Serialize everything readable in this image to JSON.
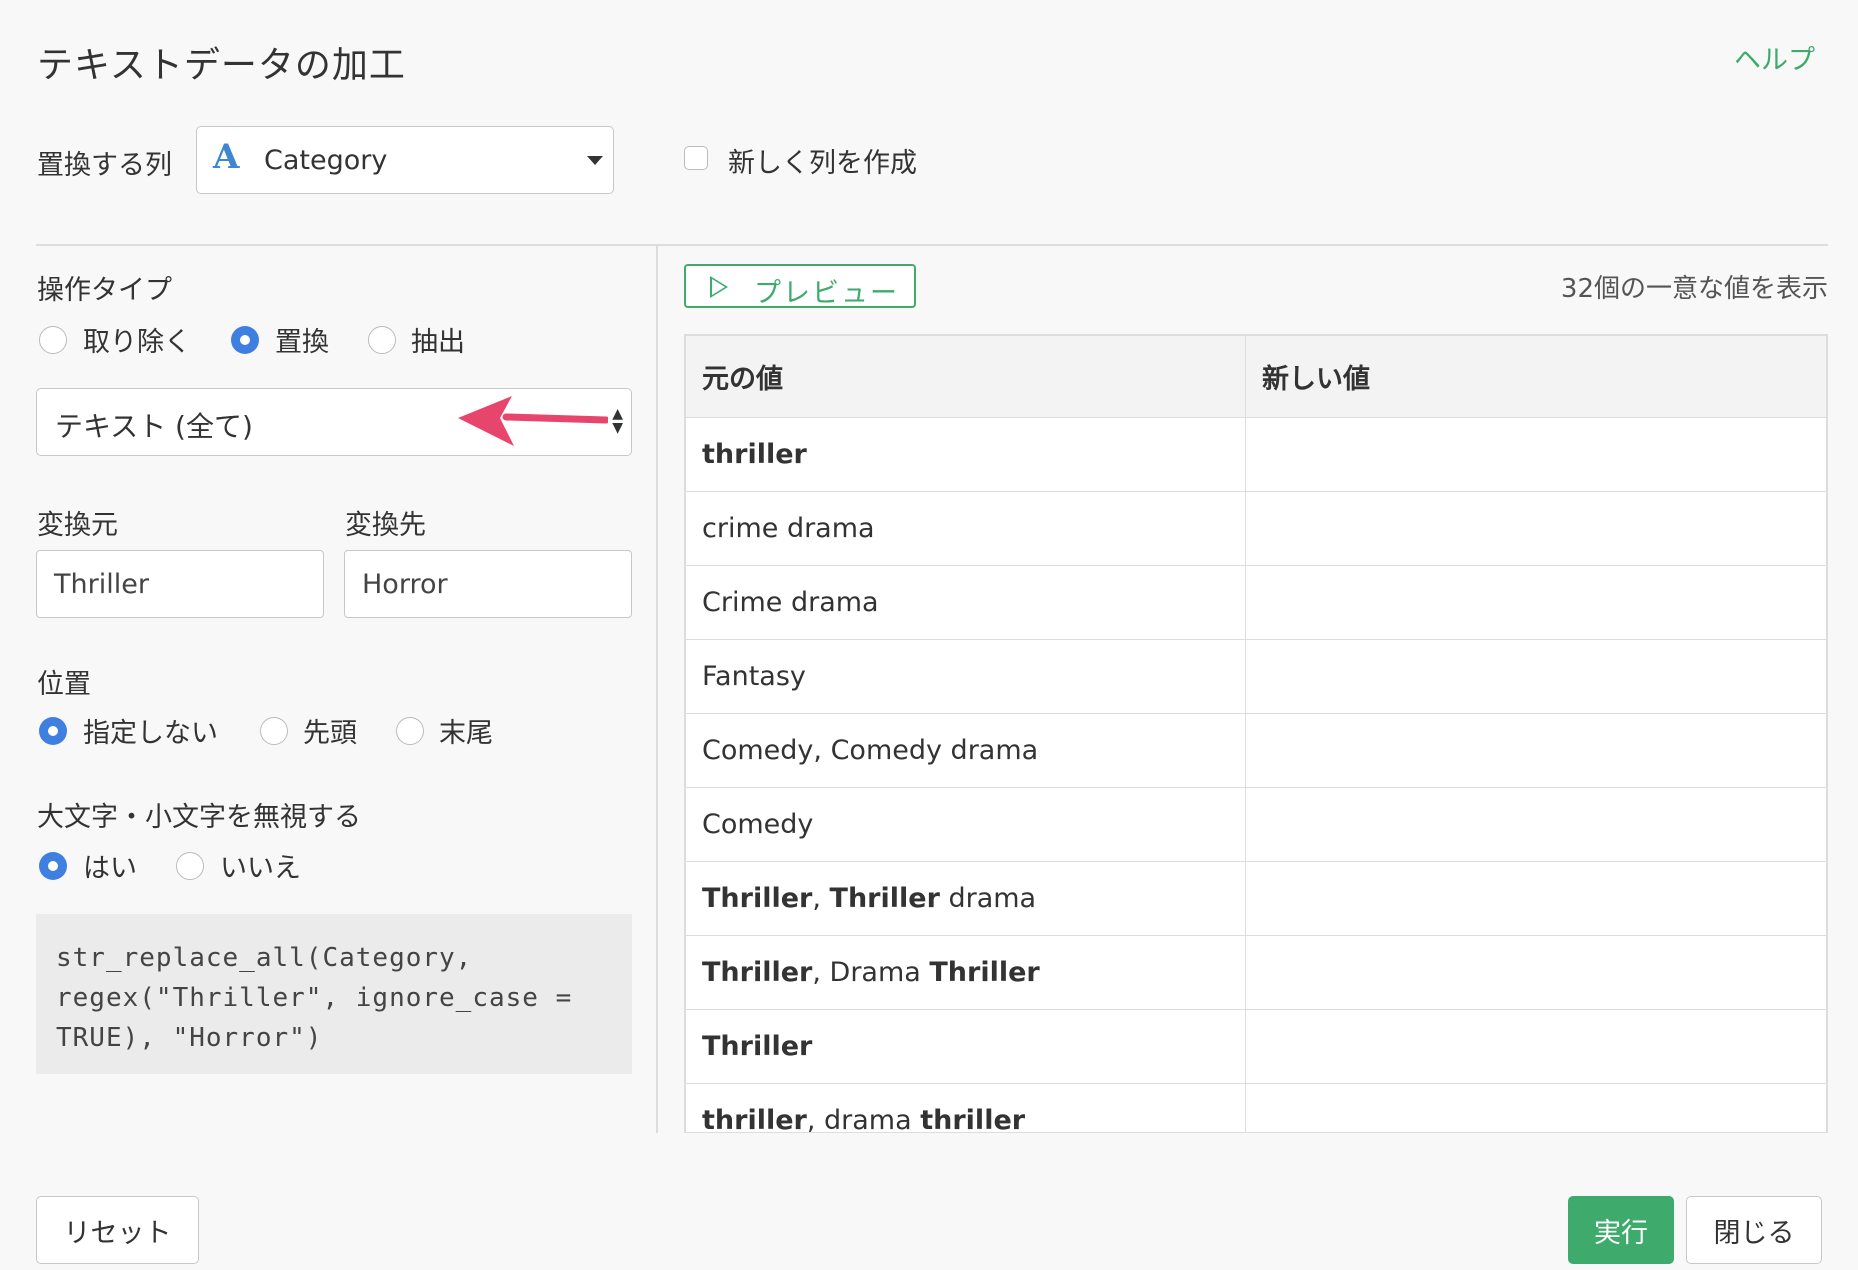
{
  "header": {
    "title": "テキストデータの加工",
    "help": "ヘルプ"
  },
  "column": {
    "label": "置換する列",
    "type_icon": "A",
    "selected": "Category",
    "new_column_label": "新しく列を作成",
    "new_column_checked": false
  },
  "operation": {
    "label": "操作タイプ",
    "options": [
      "取り除く",
      "置換",
      "抽出"
    ],
    "selected": "置換"
  },
  "text_type": {
    "selected": "テキスト (全て)"
  },
  "from": {
    "label": "変換元",
    "value": "Thriller"
  },
  "to": {
    "label": "変換先",
    "value": "Horror"
  },
  "position": {
    "label": "位置",
    "options": [
      "指定しない",
      "先頭",
      "末尾"
    ],
    "selected": "指定しない"
  },
  "ignore_case": {
    "label": "大文字・小文字を無視する",
    "options": [
      "はい",
      "いいえ"
    ],
    "selected": "はい"
  },
  "code": "str_replace_all(Category,\nregex(\"Thriller\", ignore_case =\nTRUE), \"Horror\")",
  "preview": {
    "button_label": "プレビュー",
    "unique_count_text": "32個の一意な値を表示",
    "columns": [
      "元の値",
      "新しい値"
    ],
    "rows": [
      {
        "segments": [
          {
            "t": "thriller",
            "b": true
          }
        ],
        "new": ""
      },
      {
        "segments": [
          {
            "t": "crime drama",
            "b": false
          }
        ],
        "new": ""
      },
      {
        "segments": [
          {
            "t": "Crime drama",
            "b": false
          }
        ],
        "new": ""
      },
      {
        "segments": [
          {
            "t": "Fantasy",
            "b": false
          }
        ],
        "new": ""
      },
      {
        "segments": [
          {
            "t": "Comedy, Comedy drama",
            "b": false
          }
        ],
        "new": ""
      },
      {
        "segments": [
          {
            "t": "Comedy",
            "b": false
          }
        ],
        "new": ""
      },
      {
        "segments": [
          {
            "t": "Thriller",
            "b": true
          },
          {
            "t": ", ",
            "b": false
          },
          {
            "t": "Thriller",
            "b": true
          },
          {
            "t": " drama",
            "b": false
          }
        ],
        "new": ""
      },
      {
        "segments": [
          {
            "t": "Thriller",
            "b": true
          },
          {
            "t": ", Drama ",
            "b": false
          },
          {
            "t": "Thriller",
            "b": true
          }
        ],
        "new": ""
      },
      {
        "segments": [
          {
            "t": "Thriller",
            "b": true
          }
        ],
        "new": ""
      },
      {
        "segments": [
          {
            "t": "thriller",
            "b": true
          },
          {
            "t": ", drama ",
            "b": false
          },
          {
            "t": "thriller",
            "b": true
          }
        ],
        "new": ""
      }
    ]
  },
  "footer": {
    "reset": "リセット",
    "run": "実行",
    "close": "閉じる"
  },
  "colors": {
    "accent_green": "#3eaa6c",
    "radio_blue": "#3f7fe0",
    "arrow_pink": "#e8456c"
  }
}
